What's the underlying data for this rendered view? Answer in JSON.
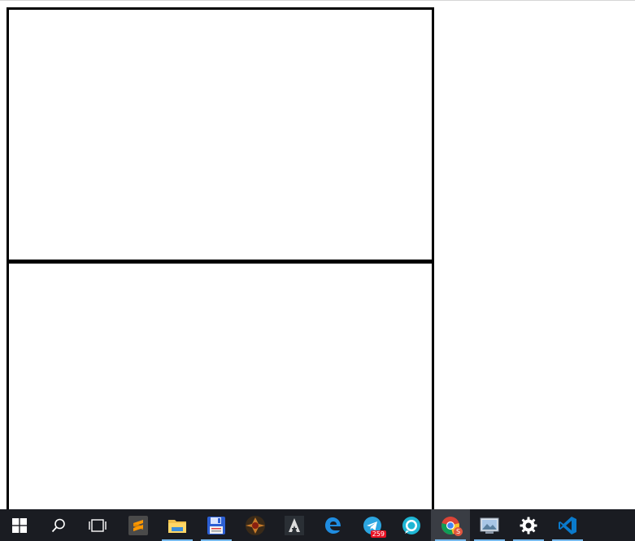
{
  "taskbar": {
    "items": [
      {
        "name": "start-button",
        "icon": "windows-logo-icon"
      },
      {
        "name": "search-button",
        "icon": "search-icon"
      },
      {
        "name": "task-view-button",
        "icon": "task-view-icon"
      },
      {
        "name": "sublime-text-app",
        "icon": "sublime-text-icon"
      },
      {
        "name": "file-explorer-app",
        "icon": "folder-icon"
      },
      {
        "name": "save-app",
        "icon": "floppy-disk-icon"
      },
      {
        "name": "game-app",
        "icon": "game-emblem-icon"
      },
      {
        "name": "assassins-creed-app",
        "icon": "assassins-creed-icon"
      },
      {
        "name": "edge-app",
        "icon": "edge-icon"
      },
      {
        "name": "telegram-app",
        "icon": "telegram-icon"
      },
      {
        "name": "chat-app",
        "icon": "chat-bubble-icon"
      },
      {
        "name": "chrome-app",
        "icon": "chrome-icon"
      },
      {
        "name": "photo-viewer-app",
        "icon": "photo-viewer-icon"
      },
      {
        "name": "settings-app",
        "icon": "gear-icon"
      },
      {
        "name": "vscode-app",
        "icon": "vscode-icon"
      }
    ],
    "telegram_badge": "259",
    "chrome_profile_initial": "S"
  },
  "colors": {
    "taskbar_bg": "#1a1c22",
    "running_indicator": "#76b9ed",
    "accent_blue": "#0078d7"
  }
}
